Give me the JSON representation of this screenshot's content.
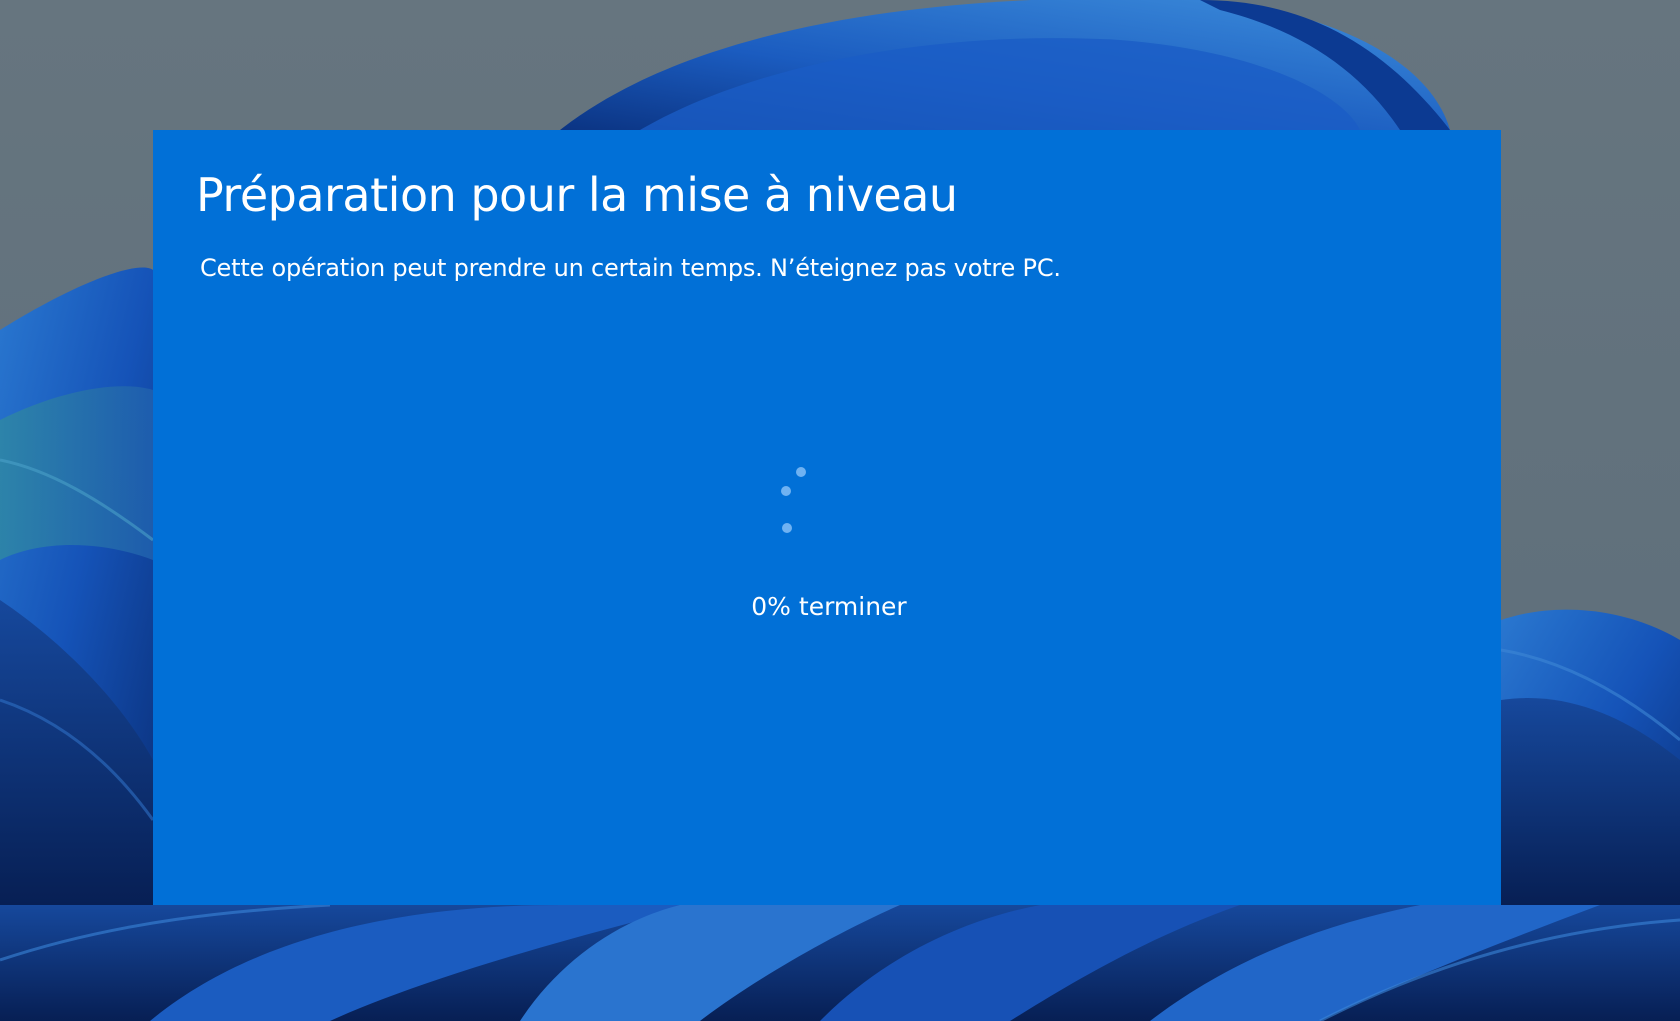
{
  "wallpaper": {
    "description_icon": "windows-bloom-wallpaper",
    "colors": {
      "sky": "#63737f",
      "bloom_dark": "#0b3a8c",
      "bloom_mid": "#1a5bc4",
      "bloom_light": "#3f86d8",
      "bloom_teal": "#2f7fa8"
    }
  },
  "dialog": {
    "title": "Préparation pour la mise à niveau",
    "subtitle": "Cette opération peut prendre un certain temps. N’éteignez pas votre PC.",
    "progress_text": "0% terminer",
    "progress_percent": 0,
    "spinner_icon": "loading-dots-icon",
    "background_color": "#0170d7",
    "text_color": "#ffffff",
    "spinner_color": "#6fb2f2"
  }
}
